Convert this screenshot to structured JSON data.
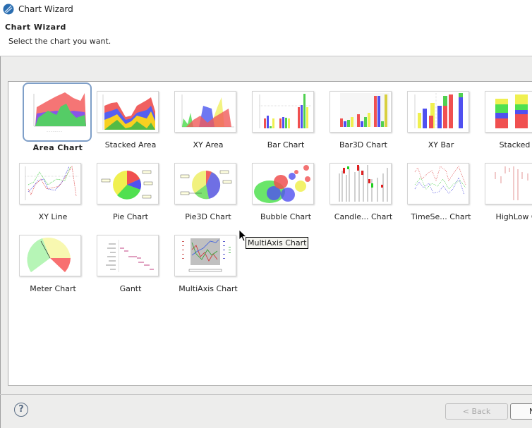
{
  "window": {
    "title": "Chart Wizard",
    "icon": "eclipse-birt-icon"
  },
  "header": {
    "title": "Chart Wizard",
    "subtitle": "Select the chart you want."
  },
  "charts": [
    {
      "label": "Area Chart",
      "icon": "area-chart-thumbnail",
      "selected": true
    },
    {
      "label": "Stacked Area",
      "icon": "stacked-area-thumbnail"
    },
    {
      "label": "XY Area",
      "icon": "xy-area-thumbnail"
    },
    {
      "label": "Bar Chart",
      "icon": "bar-chart-thumbnail"
    },
    {
      "label": "Bar3D Chart",
      "icon": "bar3d-chart-thumbnail"
    },
    {
      "label": "XY Bar",
      "icon": "xy-bar-thumbnail"
    },
    {
      "label": "Stacked B",
      "icon": "stacked-bar-thumbnail"
    },
    {
      "label": "XY Line",
      "icon": "xy-line-thumbnail"
    },
    {
      "label": "Pie Chart",
      "icon": "pie-chart-thumbnail"
    },
    {
      "label": "Pie3D Chart",
      "icon": "pie3d-chart-thumbnail"
    },
    {
      "label": "Bubble Chart",
      "icon": "bubble-chart-thumbnail"
    },
    {
      "label": "Candle... Chart",
      "icon": "candlestick-chart-thumbnail"
    },
    {
      "label": "TimeSe... Chart",
      "icon": "timeseries-chart-thumbnail"
    },
    {
      "label": "HighLow Ch",
      "icon": "highlow-chart-thumbnail"
    },
    {
      "label": "Meter Chart",
      "icon": "meter-chart-thumbnail"
    },
    {
      "label": "Gantt",
      "icon": "gantt-chart-thumbnail"
    },
    {
      "label": "MultiAxis Chart",
      "icon": "multiaxis-chart-thumbnail"
    }
  ],
  "tooltip": {
    "text": "MultiAxis Chart"
  },
  "footer": {
    "help_icon": "?",
    "back_label": "< Back",
    "next_label": "N"
  },
  "colors": {
    "selection": "#7f9fc8",
    "red": "#f05050",
    "blue": "#5050f0",
    "green": "#50d050",
    "yellow": "#f0f050"
  }
}
